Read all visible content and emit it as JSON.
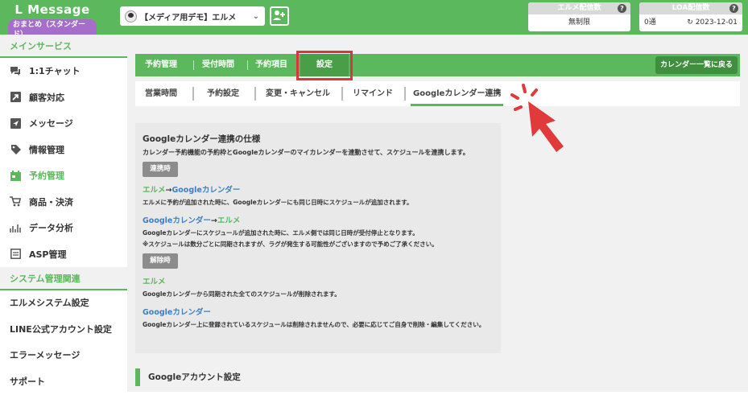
{
  "brand": {
    "name": "L Message",
    "plan": "おまとめ（スタンダード）"
  },
  "account": {
    "name": "【メディア用デモ】エルメ"
  },
  "counters": [
    {
      "label": "エルメ配信数",
      "value": "無制限"
    },
    {
      "label": "LOA配信数",
      "value": "0通",
      "date": "2023-12-01"
    }
  ],
  "sidebar": {
    "section1": "メインサービス",
    "items": [
      {
        "label": "1:1チャット",
        "icon": "chat-icon"
      },
      {
        "label": "顧客対応",
        "icon": "arrow-box-icon"
      },
      {
        "label": "メッセージ",
        "icon": "send-icon"
      },
      {
        "label": "情報管理",
        "icon": "tag-icon"
      },
      {
        "label": "予約管理",
        "icon": "calendar-icon"
      },
      {
        "label": "商品・決済",
        "icon": "cart-icon"
      },
      {
        "label": "データ分析",
        "icon": "chart-icon"
      },
      {
        "label": "ASP管理",
        "icon": "asp-icon"
      }
    ],
    "section2": "システム管理関連",
    "items2": [
      "エルメシステム設定",
      "LINE公式アカウント設定",
      "エラーメッセージ",
      "サポート"
    ]
  },
  "nav": {
    "tabs": [
      "予約管理",
      "受付時間",
      "予約項目",
      "設定"
    ],
    "back": "カレンダー一覧に戻る"
  },
  "subtabs": [
    "営業時間",
    "予約設定",
    "変更・キャンセル",
    "リマインド",
    "Googleカレンダー連携"
  ],
  "spec": {
    "title": "Googleカレンダー連携の仕様",
    "desc": "カレンダー予約機能の予約枠とGoogleカレンダーのマイカレンダーを連動させて、スケジュールを連携します。",
    "badge1": "連携時",
    "s1_from": "エルメ",
    "s1_arrow": "→",
    "s1_to": "Googleカレンダー",
    "s1_text": "エルメに予約が追加された時に、Googleカレンダーにも同じ日時にスケジュールが追加されます。",
    "s2_from": "Googleカレンダー",
    "s2_arrow": "→",
    "s2_to": "エルメ",
    "s2_text": "Googleカレンダーにスケジュールが追加された時に、エルメ側では同じ日時が受付停止となります。",
    "s2_note": "※スケジュールは数分ごとに同期されますが、ラグが発生する可能性がございますので予めご了承ください。",
    "badge2": "解除時",
    "s3_title": "エルメ",
    "s3_text": "Googleカレンダーから同期された全てのスケジュールが削除されます。",
    "s4_title": "Googleカレンダー",
    "s4_text": "Googleカレンダー上に登録されているスケジュールは削除されませんので、必要に応じてご自身で削除・編集してください。"
  },
  "account_section": "Googleアカウント設定",
  "colors": {
    "accent": "#5cb85c",
    "highlight": "#d9363e",
    "link": "#3d7fc4"
  }
}
